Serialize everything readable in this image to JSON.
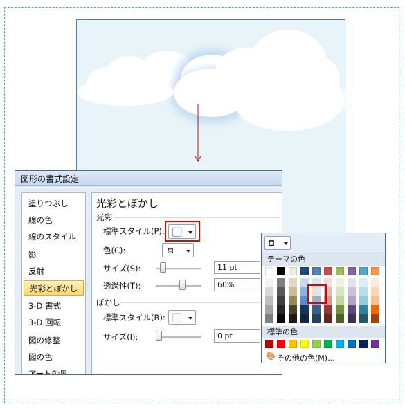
{
  "dialog": {
    "title": "図形の書式設定",
    "nav_items": [
      "塗りつぶし",
      "線の色",
      "線のスタイル",
      "影",
      "反射",
      "光彩とぼかし",
      "3-D 書式",
      "3-D 回転",
      "図の修整",
      "図の色",
      "アート効果"
    ],
    "selected_nav_index": 5,
    "panel": {
      "heading": "光彩とぼかし",
      "glow_section": "光彩",
      "glow_preset_label": "標準スタイル(P):",
      "glow_color_label": "色(C):",
      "glow_size_label": "サイズ(S):",
      "glow_size_value": "11 pt",
      "glow_transparency_label": "透過性(T):",
      "glow_transparency_value": "60%",
      "soft_section": "ぼかし",
      "soft_preset_label": "標準スタイル(R):",
      "soft_size_label": "サイズ(I):",
      "soft_size_value": "0 pt"
    }
  },
  "palette": {
    "theme_header": "テーマの色",
    "standard_header": "標準の色",
    "more_colors": "その他の色(M)...",
    "theme_top": [
      "#ffffff",
      "#000000",
      "#eeece1",
      "#1f497d",
      "#4f81bd",
      "#c0504d",
      "#9bbb59",
      "#8064a2",
      "#4bacc6",
      "#f79646"
    ],
    "theme_tints": [
      [
        "#f2f2f2",
        "#7f7f7f",
        "#ddd9c3",
        "#c6d9f0",
        "#dbe5f1",
        "#f2dcdb",
        "#ebf1dd",
        "#e5e0ec",
        "#dbeef3",
        "#fdeada"
      ],
      [
        "#d8d8d8",
        "#595959",
        "#c4bd97",
        "#8db3e2",
        "#b8cce4",
        "#e5b9b7",
        "#d7e3bc",
        "#ccc1d9",
        "#b7dde8",
        "#fbd5b5"
      ],
      [
        "#bfbfbf",
        "#3f3f3f",
        "#938953",
        "#548dd4",
        "#95b3d7",
        "#d99694",
        "#c3d69b",
        "#b2a2c7",
        "#92cddc",
        "#fac08f"
      ],
      [
        "#a5a5a5",
        "#262626",
        "#494429",
        "#17365d",
        "#366092",
        "#953734",
        "#76923c",
        "#5f497a",
        "#31859b",
        "#e36c09"
      ],
      [
        "#7f7f7f",
        "#0c0c0c",
        "#1d1b10",
        "#0f243e",
        "#244061",
        "#632423",
        "#4f6128",
        "#3f3151",
        "#205867",
        "#974806"
      ]
    ],
    "standard": [
      "#c00000",
      "#ff0000",
      "#ffc000",
      "#ffff00",
      "#92d050",
      "#00b050",
      "#00b0f0",
      "#0070c0",
      "#002060",
      "#7030a0"
    ],
    "selected_color": "#dbe5f1"
  },
  "annotation_color": "#e00000"
}
